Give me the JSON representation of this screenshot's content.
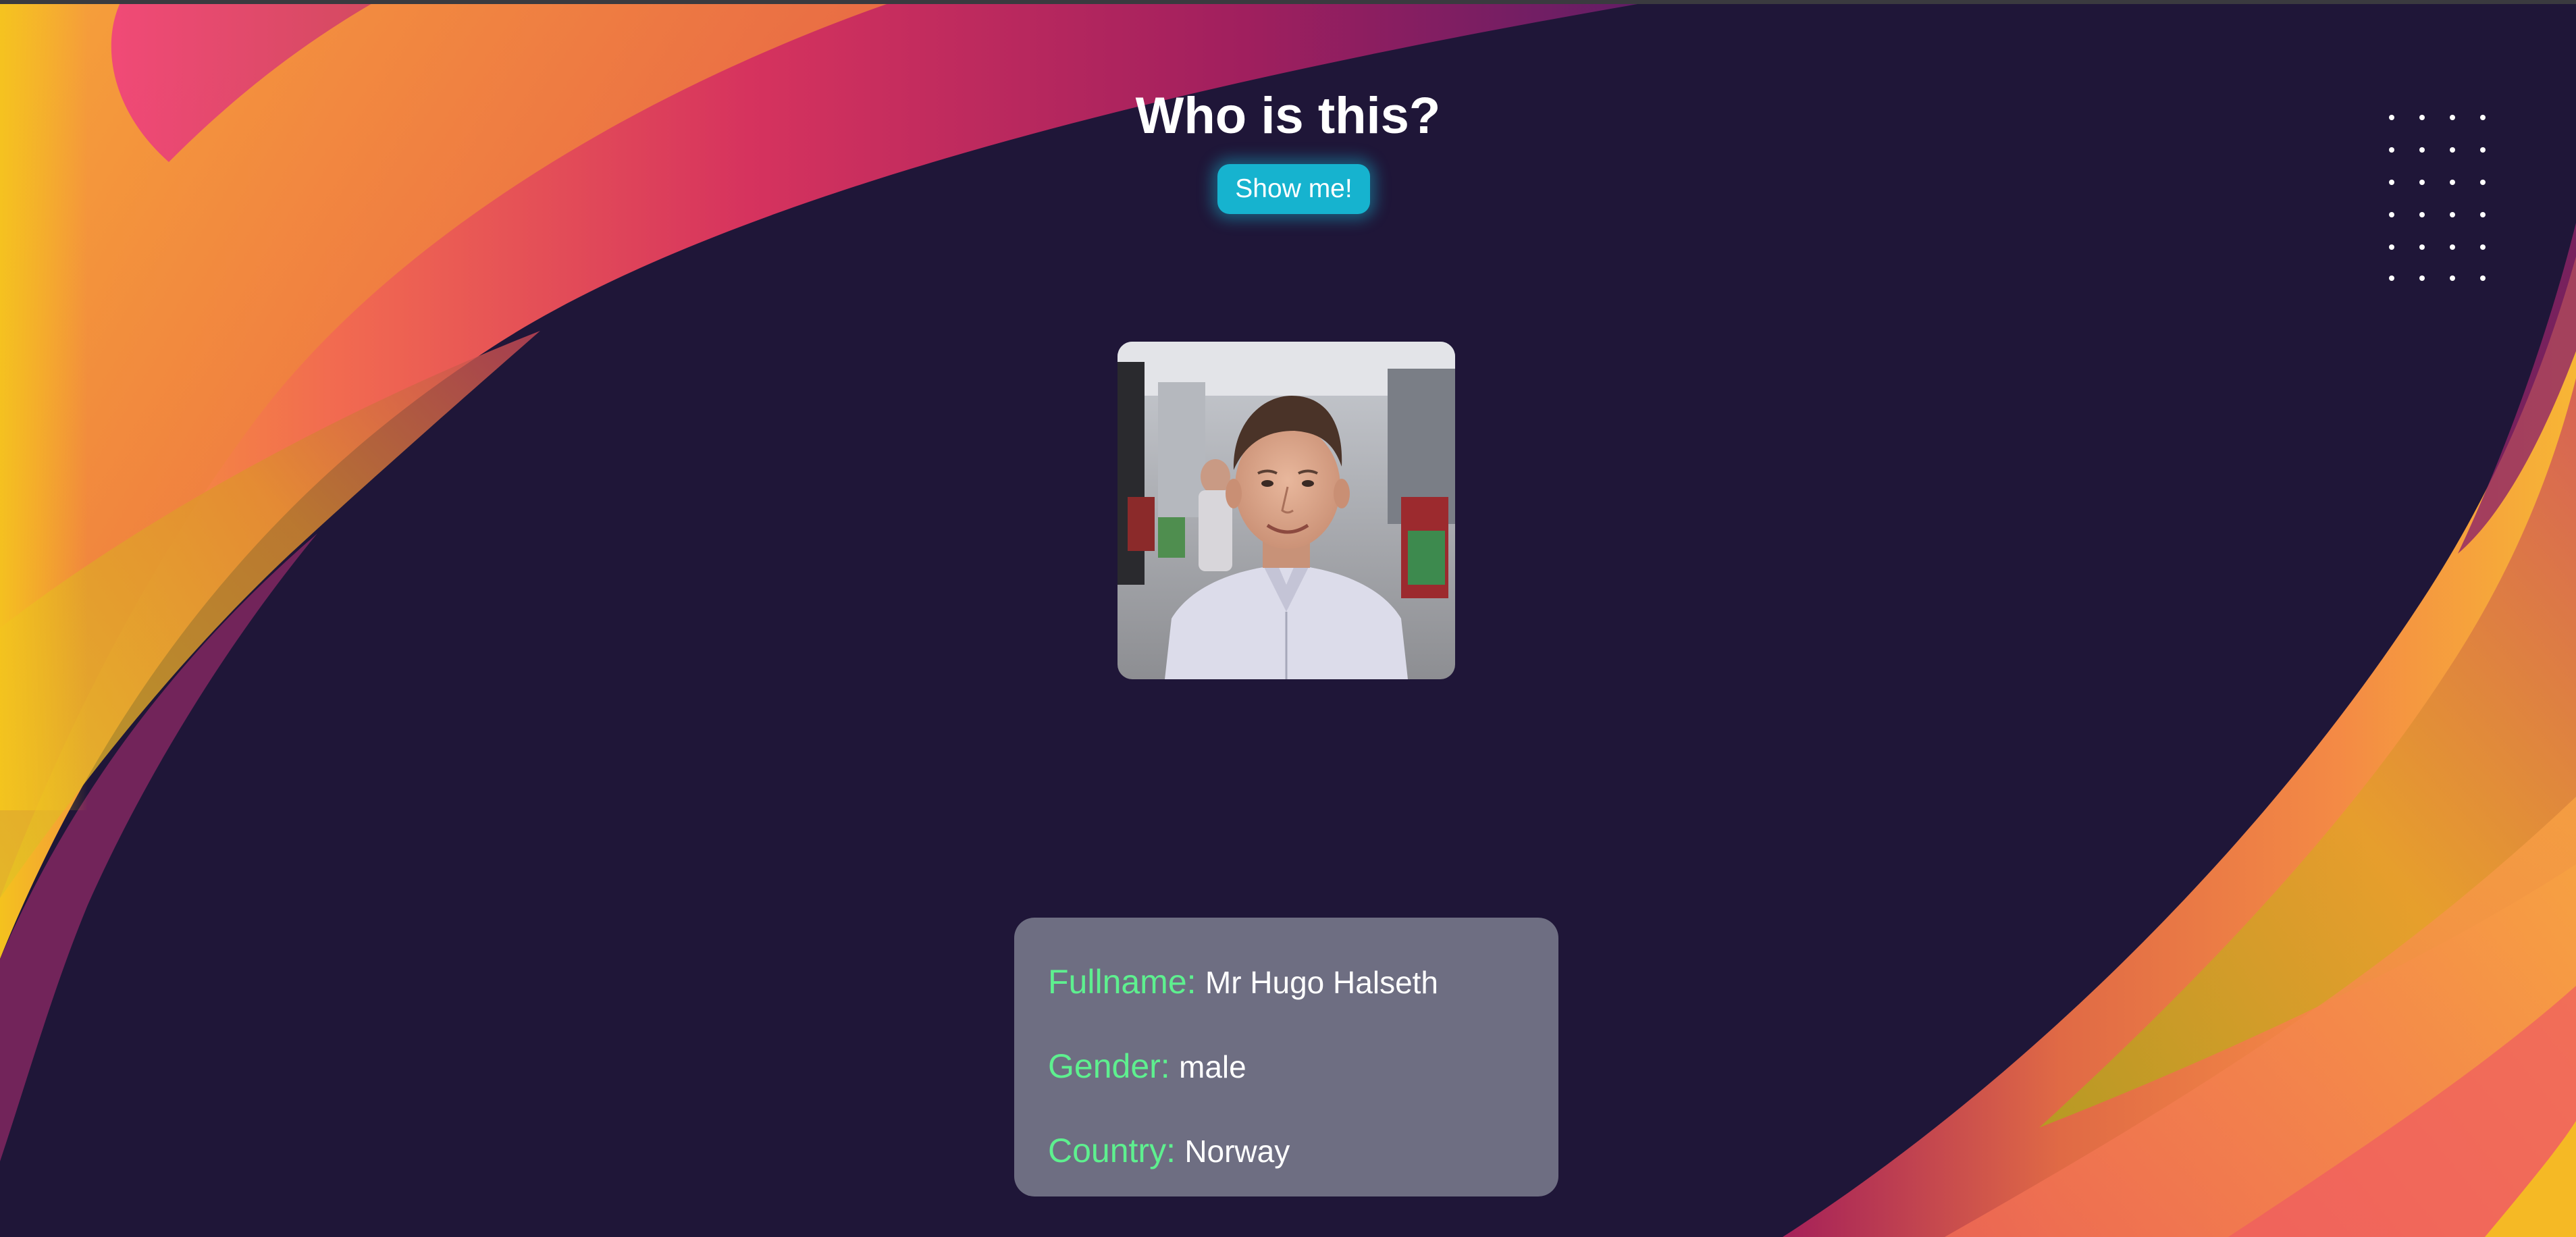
{
  "header": {
    "title": "Who is this?",
    "show_button_label": "Show me!"
  },
  "profile": {
    "photo_alt": "Profile photo",
    "fields": [
      {
        "label": "Fullname:",
        "value": "Mr Hugo Halseth"
      },
      {
        "label": "Gender:",
        "value": "male"
      },
      {
        "label": "Country:",
        "value": "Norway"
      }
    ]
  },
  "colors": {
    "background": "#1f1638",
    "button": "#16b3cf",
    "card": "#6e6e82",
    "label_accent": "#5ef08f",
    "wave_magenta": "#c2306e",
    "wave_orange": "#f08a3a",
    "wave_yellow": "#f2c21d"
  },
  "icons": {
    "dots": "dot-grid-decoration"
  }
}
